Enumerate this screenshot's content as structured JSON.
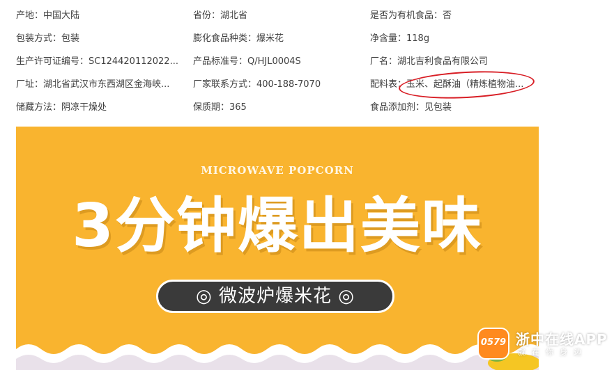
{
  "attributes": [
    [
      "产地：中国大陆",
      "省份：湖北省",
      "是否为有机食品：否"
    ],
    [
      "包装方式：包装",
      "膨化食品种类：爆米花",
      "净含量：118g"
    ],
    [
      "生产许可证编号：SC124420112022...",
      "产品标准号：Q/HJL0004S",
      "厂名：湖北吉利食品有限公司"
    ],
    [
      "厂址：湖北省武汉市东西湖区金海峡...",
      "厂家联系方式：400-188-7070",
      "配料表：玉米、起酥油（精炼植物油..."
    ],
    [
      "储藏方法：阴凉干燥处",
      "保质期：365",
      "食品添加剂：见包装"
    ]
  ],
  "banner": {
    "subtitle": "MICROWAVE POPCORN",
    "title": "3分钟爆出美味",
    "pill_text": "◎ 微波炉爆米花 ◎",
    "bg_color": "#f9b42f"
  },
  "watermark": {
    "badge": "0579",
    "name": "浙中在线APP",
    "tagline": "就在你身边"
  },
  "colors": {
    "highlight": "#d81e25",
    "text": "#404040"
  }
}
